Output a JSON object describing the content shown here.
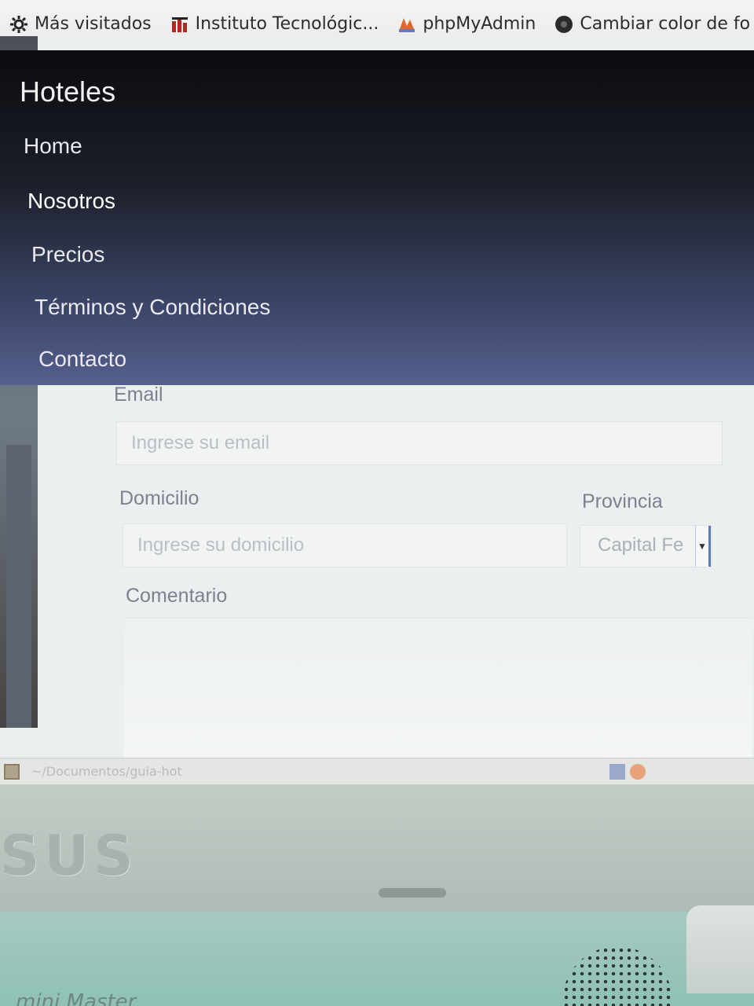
{
  "bookmarks": [
    {
      "label": "Más visitados",
      "icon": "gear-icon"
    },
    {
      "label": "Instituto Tecnológic...",
      "icon": "institute-logo-icon"
    },
    {
      "label": "phpMyAdmin",
      "icon": "phpmyadmin-logo-icon"
    },
    {
      "label": "Cambiar color de fo",
      "icon": "site-favicon-icon"
    }
  ],
  "navbar": {
    "brand": "Hoteles",
    "items": [
      "Home",
      "Nosotros",
      "Precios",
      "Términos y Condiciones",
      "Contacto"
    ]
  },
  "form": {
    "email_label": "Email",
    "email_placeholder": "Ingrese su email",
    "address_label": "Domicilio",
    "address_placeholder": "Ingrese su domicilio",
    "province_label": "Provincia",
    "province_value": "Capital Fe",
    "comment_label": "Comentario"
  },
  "taskbar": {
    "path": "~/Documentos/guia-hot"
  },
  "laptop": {
    "logo": "SUS",
    "base_label": "mini Master"
  }
}
